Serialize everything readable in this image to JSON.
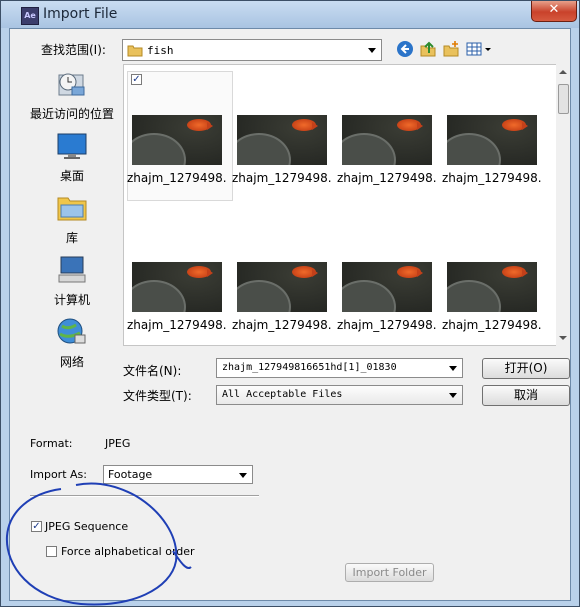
{
  "window": {
    "title": "Import File",
    "app_icon_text": "Ae",
    "close_glyph": "✕"
  },
  "toolbar": {
    "look_in_label": "查找范围(I):",
    "look_in_value": "fish",
    "icons": [
      "back-icon",
      "up-folder-icon",
      "new-folder-icon",
      "view-menu-icon"
    ]
  },
  "places": [
    {
      "label": "最近访问的位置",
      "icon": "recent-places-icon"
    },
    {
      "label": "桌面",
      "icon": "desktop-icon"
    },
    {
      "label": "库",
      "icon": "library-icon"
    },
    {
      "label": "计算机",
      "icon": "computer-icon"
    },
    {
      "label": "网络",
      "icon": "network-icon"
    }
  ],
  "files": [
    {
      "name": "zhajm_1279498..."
    },
    {
      "name": "zhajm_1279498..."
    },
    {
      "name": "zhajm_1279498..."
    },
    {
      "name": "zhajm_1279498..."
    },
    {
      "name": "zhajm_1279498..."
    },
    {
      "name": "zhajm_1279498..."
    },
    {
      "name": "zhajm_1279498..."
    },
    {
      "name": "zhajm_1279498..."
    }
  ],
  "filename": {
    "label": "文件名(N):",
    "value": "zhajm_127949816651hd[1]_01830"
  },
  "filetype": {
    "label": "文件类型(T):",
    "value": "All Acceptable Files"
  },
  "buttons": {
    "open": "打开(O)",
    "cancel": "取消",
    "import_folder": "Import Folder"
  },
  "format": {
    "label": "Format:",
    "value": "JPEG"
  },
  "import_as": {
    "label": "Import As:",
    "value": "Footage"
  },
  "options": {
    "jpeg_sequence": {
      "label": "JPEG Sequence",
      "checked": true
    },
    "force_alpha": {
      "label": "Force alphabetical order",
      "checked": false
    }
  },
  "colors": {
    "window_frame": "#b9d1ea",
    "client": "#f0f0f0",
    "close_button": "#c9422b",
    "annotation": "#1f3fb5"
  }
}
